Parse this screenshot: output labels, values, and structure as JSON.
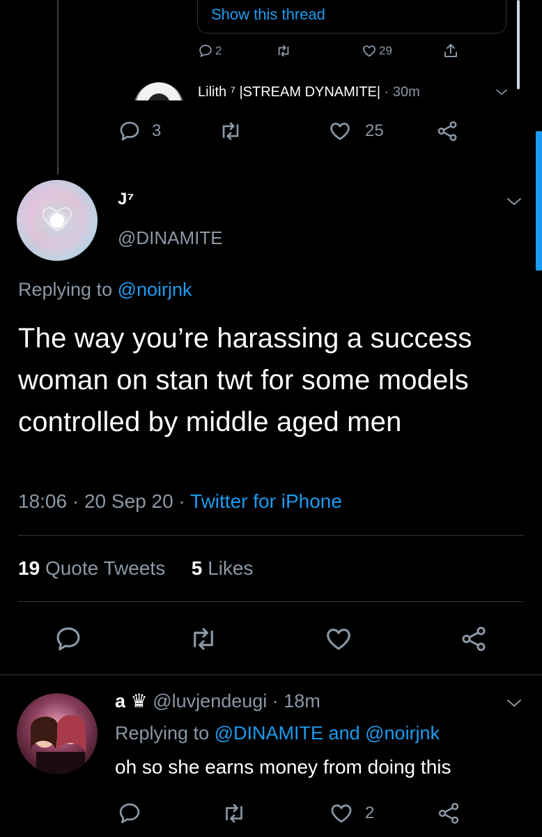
{
  "quoted_thread": {
    "show_thread_label": "Show this thread",
    "reply_count": "2",
    "like_count": "29",
    "next_user_line": "Lilith ⁷ |STREAM DYNAMITE|",
    "next_time": "· 30m"
  },
  "parent_actions": {
    "reply_count": "3",
    "like_count": "25"
  },
  "main_tweet": {
    "display_name": "J⁷",
    "handle": "@DINAMITE",
    "replying_prefix": "Replying to",
    "replying_to": "@noirjnk",
    "text": "The way you’re harassing a success woman on stan twt for some models controlled by middle aged men",
    "time": "18:06",
    "date": "20 Sep 20",
    "source": "Twitter for iPhone",
    "quote_count": "19",
    "quote_label": "Quote Tweets",
    "like_count": "5",
    "like_label": "Likes"
  },
  "reply_tweet": {
    "display_name": "a ♛",
    "handle": "@luvjendeugi",
    "time": "· 18m",
    "replying_prefix": "Replying to",
    "replying_to_1": "@DINAMITE",
    "and_word": "and",
    "replying_to_2": "@noirjnk",
    "text": "oh so she earns money from doing this",
    "like_count": "2"
  },
  "colors": {
    "accent": "#1d9bf0",
    "muted": "#8b98a5",
    "background": "#000000",
    "divider": "#2f3336"
  }
}
